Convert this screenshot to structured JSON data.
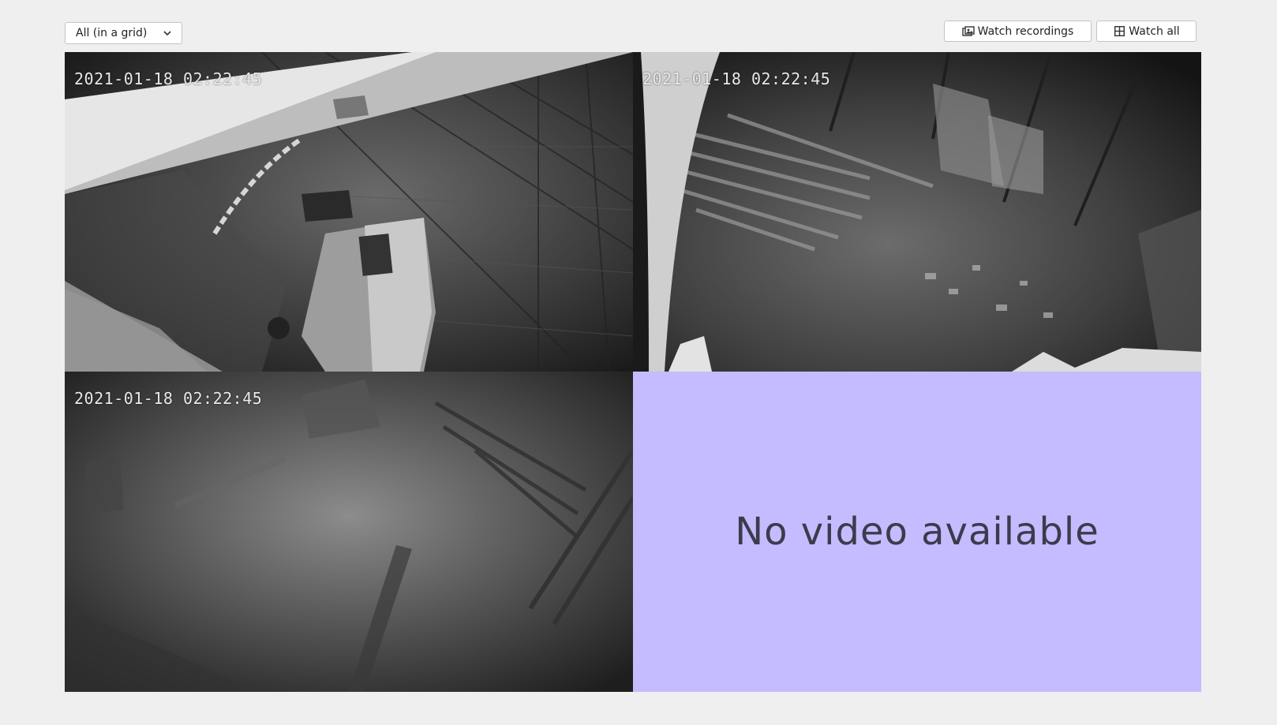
{
  "view_select": {
    "value": "All (in a grid)",
    "icon": "chevron-down-icon"
  },
  "toolbar": {
    "watch_recordings": {
      "label": "Watch recordings",
      "icon": "film-icon"
    },
    "watch_all": {
      "label": "Watch all",
      "icon": "grid-icon"
    }
  },
  "cameras": [
    {
      "timestamp": "2021-01-18 02:22:45"
    },
    {
      "timestamp": "2021-01-18 02:22:45"
    },
    {
      "timestamp": "2021-01-18 02:22:45"
    }
  ],
  "empty_slot": {
    "message": "No video available",
    "background": "#c4bcfe"
  }
}
